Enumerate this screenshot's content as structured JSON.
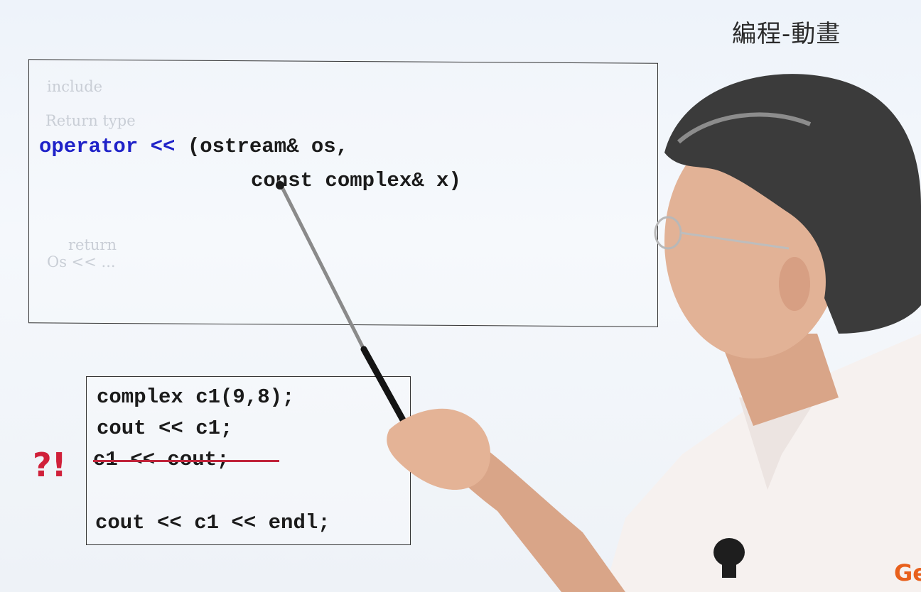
{
  "corner_title": "編程-動畫",
  "main_box": {
    "faint_notes": {
      "include": "include",
      "return_type": "Return type",
      "return": "return",
      "os_stream": "Os << ..."
    },
    "signature_keyword": "operator <<",
    "signature_line1_rest": " (ostream& os,",
    "signature_line2": "const complex& x)"
  },
  "example_box": {
    "line1": "complex c1(9,8);",
    "line2": "cout << c1;",
    "line3_struck": "c1 << cout;",
    "line4": "cout << c1 << endl;"
  },
  "annotation_mark": "?!",
  "logo_text": "Ge",
  "colors": {
    "keyword": "#1f22c8",
    "strike": "#c0243a",
    "annotation": "#d0203a",
    "logo": "#e8601c"
  }
}
